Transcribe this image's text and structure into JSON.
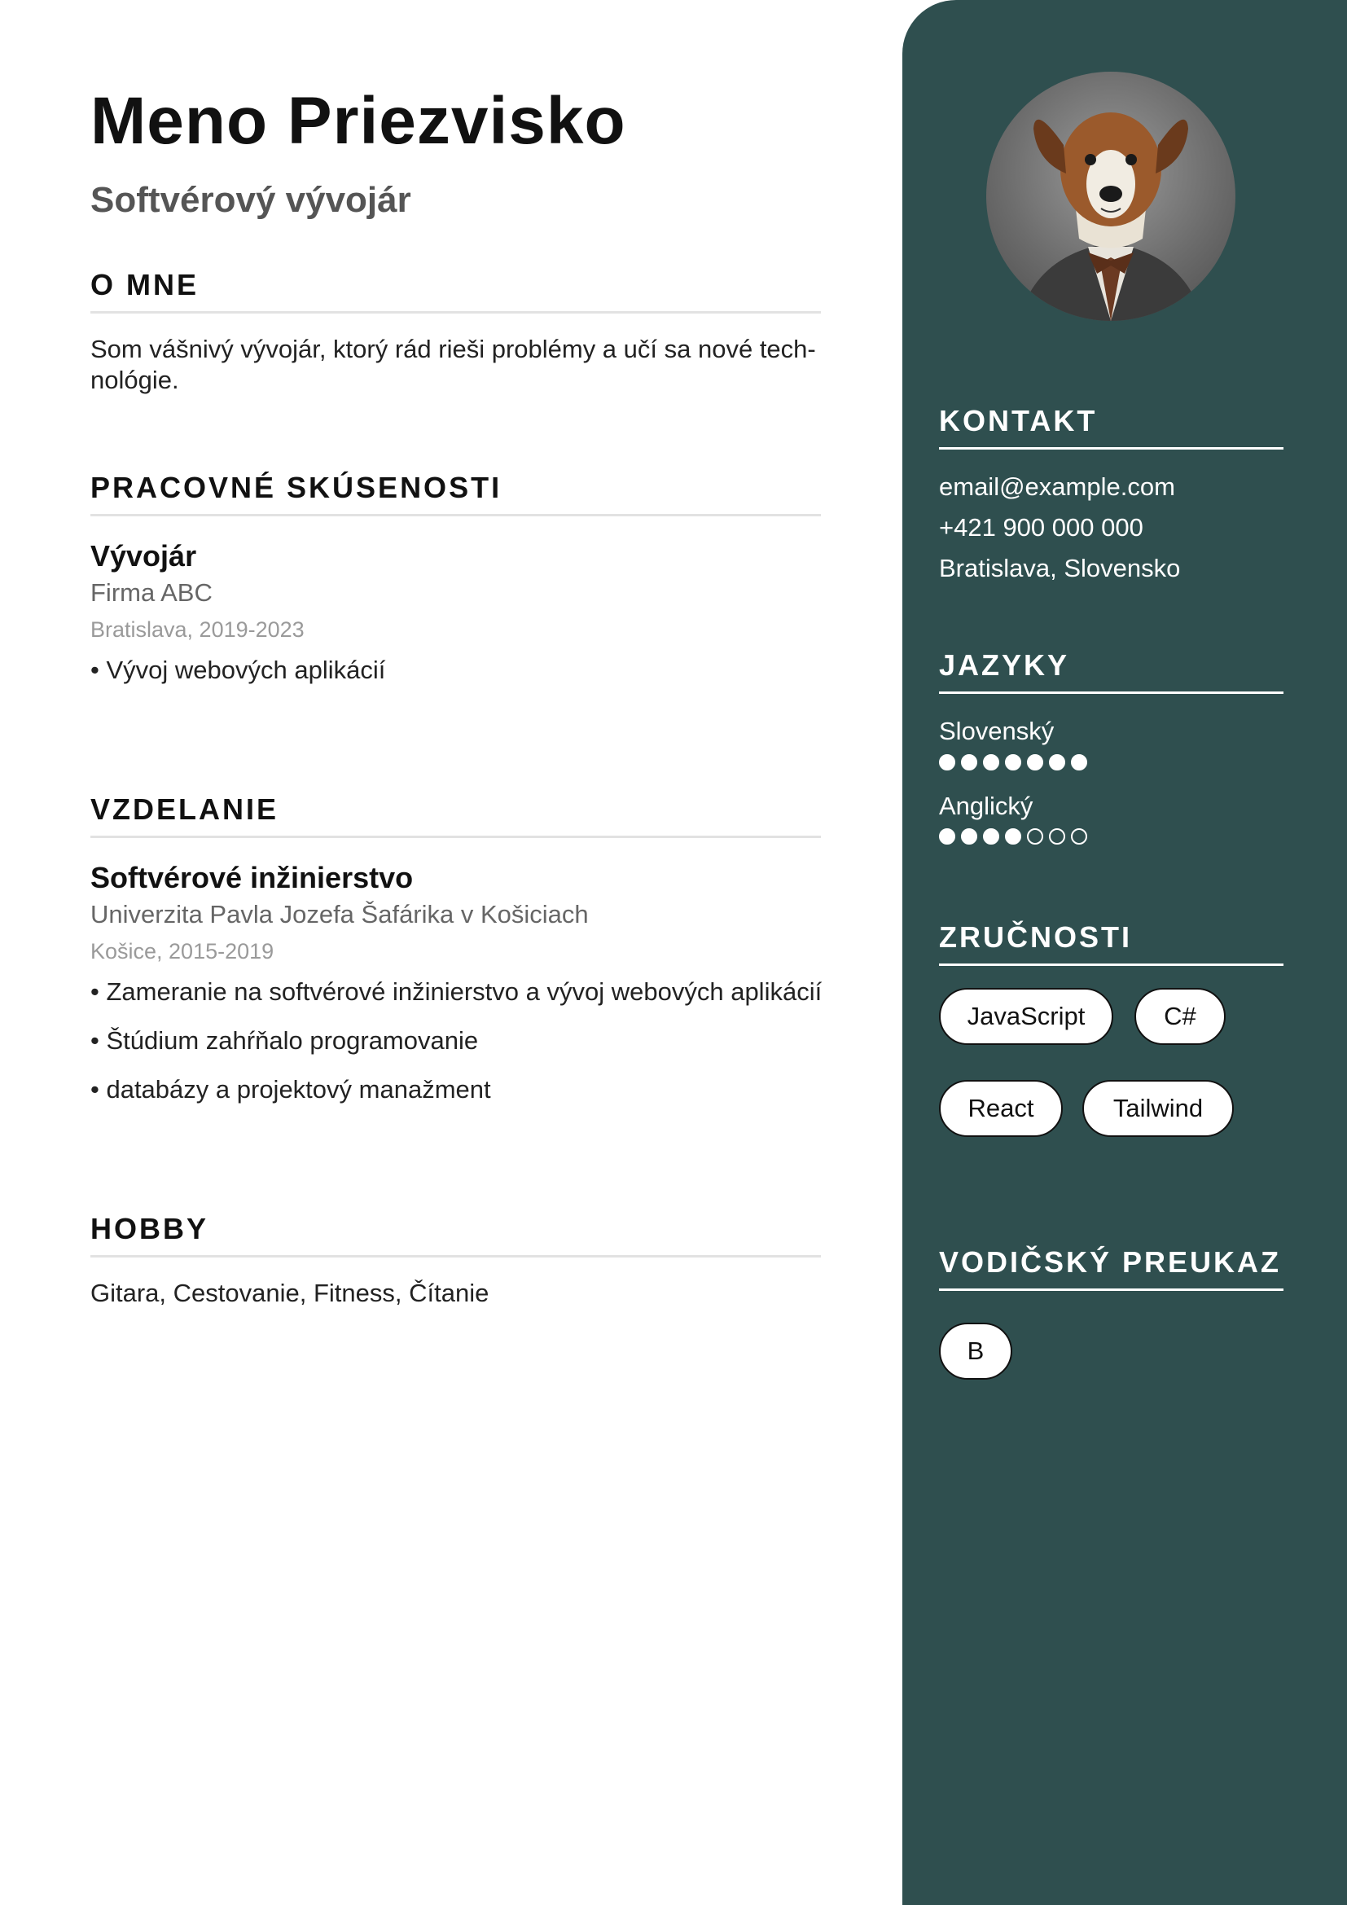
{
  "header": {
    "name": "Meno Priezvisko",
    "role": "Softvérový vývojár"
  },
  "about": {
    "title": "O MNE",
    "text": "Som vášnivý vývojár, ktorý rád rieši problémy a učí sa nové tech-nológie."
  },
  "experience": {
    "title": "PRACOVNÉ SKÚSENOSTI",
    "items": [
      {
        "position": "Vývojár",
        "company": "Firma ABC",
        "meta": "Bratislava, 2019-2023",
        "bullets": [
          "• Vývoj webových aplikácií"
        ]
      }
    ]
  },
  "education": {
    "title": "VZDELANIE",
    "items": [
      {
        "degree": "Softvérové inžinierstvo",
        "school": "Univerzita Pavla Jozefa Šafárika v Košiciach",
        "meta": "Košice, 2015-2019",
        "bullets": [
          "• Zameranie na softvérové inžinierstvo a vývoj webových aplikácií",
          "• Štúdium zahŕňalo programovanie",
          "• databázy a projektový manažment"
        ]
      }
    ]
  },
  "hobby": {
    "title": "HOBBY",
    "text": "Gitara, Cestovanie, Fitness, Čítanie"
  },
  "sidebar": {
    "photo_icon": "dog-in-suit-portrait",
    "background_color": "#2f4f4f",
    "contact": {
      "title": "KONTAKT",
      "email": "email@example.com",
      "phone": "+421 900 000 000",
      "location": "Bratislava, Slovensko"
    },
    "languages": {
      "title": "JAZYKY",
      "items": [
        {
          "name": "Slovenský",
          "level": 7,
          "max": 7
        },
        {
          "name": "Anglický",
          "level": 4,
          "max": 7
        }
      ]
    },
    "skills": {
      "title": "ZRUČNOSTI",
      "items": [
        "JavaScript",
        "C#",
        "React",
        "Tailwind"
      ]
    },
    "license": {
      "title": "VODIČSKÝ PREUKAZ",
      "items": [
        "B"
      ]
    }
  }
}
